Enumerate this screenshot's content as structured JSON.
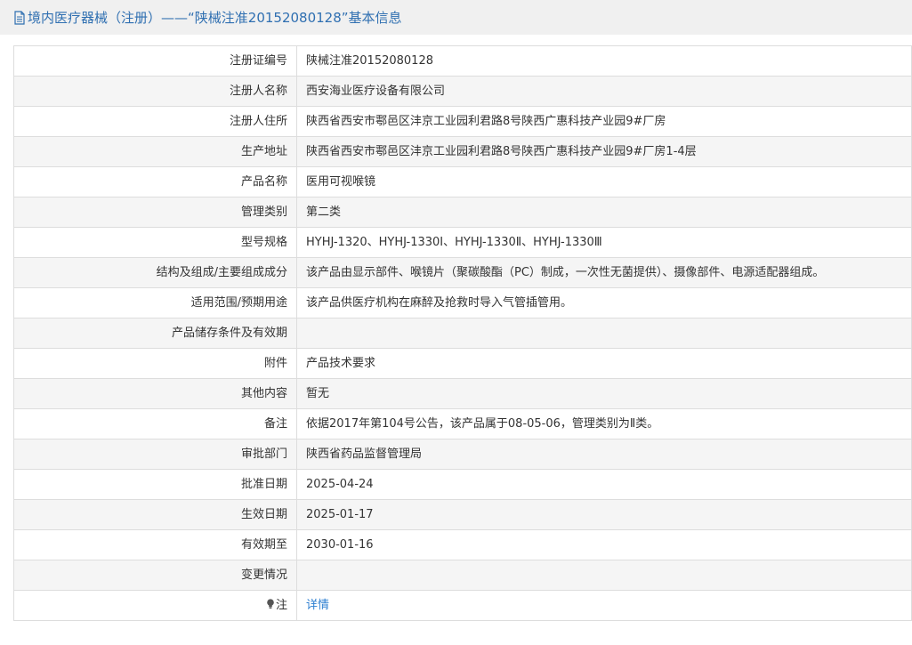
{
  "header": {
    "icon": "document-icon",
    "title": "境内医疗器械（注册）——“陕械注准20152080128”基本信息",
    "color": "#2f6fb1"
  },
  "rows": [
    {
      "label": "注册证编号",
      "value": "陕械注准20152080128"
    },
    {
      "label": "注册人名称",
      "value": "西安海业医疗设备有限公司"
    },
    {
      "label": "注册人住所",
      "value": "陕西省西安市鄠邑区沣京工业园利君路8号陕西广惠科技产业园9#厂房"
    },
    {
      "label": "生产地址",
      "value": "陕西省西安市鄠邑区沣京工业园利君路8号陕西广惠科技产业园9#厂房1-4层"
    },
    {
      "label": "产品名称",
      "value": "医用可视喉镜"
    },
    {
      "label": "管理类别",
      "value": "第二类"
    },
    {
      "label": "型号规格",
      "value": "HYHJ-1320、HYHJ-1330Ⅰ、HYHJ-1330Ⅱ、HYHJ-1330Ⅲ"
    },
    {
      "label": "结构及组成/主要组成成分",
      "value": "该产品由显示部件、喉镜片（聚碳酸酯（PC）制成，一次性无菌提供）、摄像部件、电源适配器组成。"
    },
    {
      "label": "适用范围/预期用途",
      "value": "该产品供医疗机构在麻醉及抢救时导入气管插管用。"
    },
    {
      "label": "产品储存条件及有效期",
      "value": ""
    },
    {
      "label": "附件",
      "value": "产品技术要求"
    },
    {
      "label": "其他内容",
      "value": "暂无"
    },
    {
      "label": "备注",
      "value": "依据2017年第104号公告，该产品属于08-05-06，管理类别为Ⅱ类。"
    },
    {
      "label": "审批部门",
      "value": "陕西省药品监督管理局"
    },
    {
      "label": "批准日期",
      "value": "2025-04-24"
    },
    {
      "label": "生效日期",
      "value": "2025-01-17"
    },
    {
      "label": "有效期至",
      "value": "2030-01-16"
    },
    {
      "label": "变更情况",
      "value": ""
    }
  ],
  "note_row": {
    "icon": "lightbulb-icon",
    "label": "注",
    "link_text": "详情",
    "link_color": "#2f80d1"
  },
  "colors": {
    "row_alt_background": "#f5f5f5",
    "border": "#dddddd",
    "header_background": "#f0f0f0"
  }
}
